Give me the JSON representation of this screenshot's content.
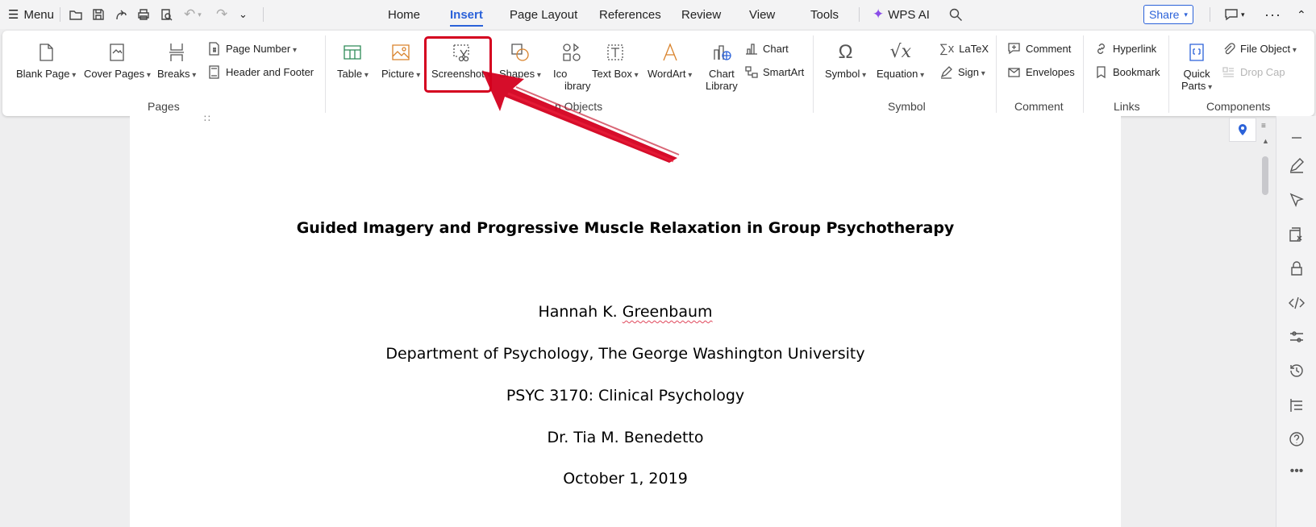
{
  "menu": {
    "label": "Menu"
  },
  "tabs": [
    {
      "label": "Home"
    },
    {
      "label": "Insert"
    },
    {
      "label": "Page Layout"
    },
    {
      "label": "References"
    },
    {
      "label": "Review"
    },
    {
      "label": "View"
    },
    {
      "label": "Tools"
    },
    {
      "label": "WPS AI"
    }
  ],
  "share": {
    "label": "Share"
  },
  "ribbon": {
    "blank_page": "Blank Page",
    "cover_pages": "Cover Pages",
    "breaks": "Breaks",
    "page_number": "Page Number",
    "header_footer": "Header and  Footer",
    "table": "Table",
    "picture": "Picture",
    "screenshot": "Screenshot",
    "shapes": "Shapes",
    "icons_1": "Ico",
    "icons_2": "ibrary",
    "text_box": "Text Box",
    "wordart": "WordArt",
    "chart_library_1": "Chart",
    "chart_library_2": "Library",
    "chart": "Chart",
    "smartart": "SmartArt",
    "symbol": "Symbol",
    "equation": "Equation",
    "latex": "LaTeX",
    "sign": "Sign",
    "comment": "Comment",
    "envelopes": "Envelopes",
    "hyperlink": "Hyperlink",
    "bookmark": "Bookmark",
    "quick_parts_1": "Quick",
    "quick_parts_2": "Parts",
    "file_object": "File Object",
    "drop_cap": "Drop Cap"
  },
  "groups": {
    "pages": "Pages",
    "objects": "n Objects",
    "symbol": "Symbol",
    "comment": "Comment",
    "links": "Links",
    "components": "Components"
  },
  "document": {
    "title": "Guided Imagery and Progressive Muscle Relaxation in Group Psychotherapy",
    "author_first": "Hannah K. ",
    "author_last": "Greenbaum",
    "department": "Department of Psychology, The George Washington University",
    "course": "PSYC 3170: Clinical Psychology",
    "instructor": "Dr. Tia M. Benedetto",
    "date": "October 1, 2019"
  },
  "colors": {
    "accent": "#2b62d9",
    "annotation": "#d4001f",
    "spell_error": "#e0475b",
    "wps_ai": "#8a4de8"
  }
}
